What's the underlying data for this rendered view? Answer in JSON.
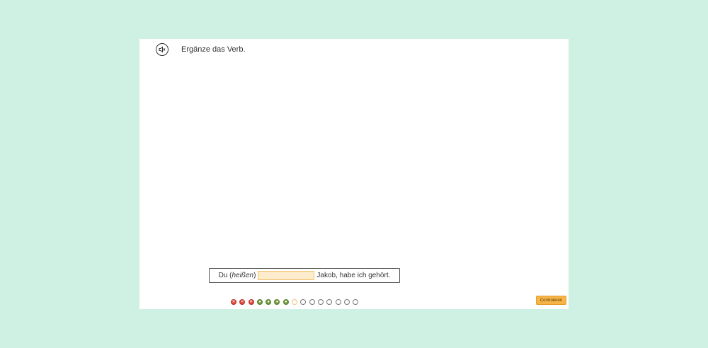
{
  "exercise": {
    "instruction": "Ergänze das Verb.",
    "sentence": {
      "before": "Du (",
      "verb": "heißen",
      "after_paren": ")",
      "input_value": "",
      "rest": "Jakob, habe ich gehört."
    }
  },
  "progress": {
    "items": [
      {
        "state": "wrong",
        "symbol": "✕"
      },
      {
        "state": "wrong",
        "symbol": "✕"
      },
      {
        "state": "wrong",
        "symbol": "✕"
      },
      {
        "state": "correct",
        "symbol": "●"
      },
      {
        "state": "correct",
        "symbol": "●"
      },
      {
        "state": "correct",
        "symbol": "●"
      },
      {
        "state": "correct",
        "symbol": "●"
      },
      {
        "state": "current",
        "symbol": ""
      },
      {
        "state": "pending",
        "symbol": ""
      },
      {
        "state": "pending",
        "symbol": ""
      },
      {
        "state": "pending",
        "symbol": ""
      },
      {
        "state": "pending",
        "symbol": ""
      },
      {
        "state": "pending",
        "symbol": ""
      },
      {
        "state": "pending",
        "symbol": ""
      },
      {
        "state": "pending",
        "symbol": ""
      }
    ]
  },
  "actions": {
    "check_label": "Controleren"
  },
  "icons": {
    "audio": "speaker-mute-icon"
  },
  "colors": {
    "background": "#cff1e3",
    "wrong": "#d9463a",
    "correct": "#6f9a3a",
    "current": "#f0c477",
    "button": "#f7b548"
  }
}
